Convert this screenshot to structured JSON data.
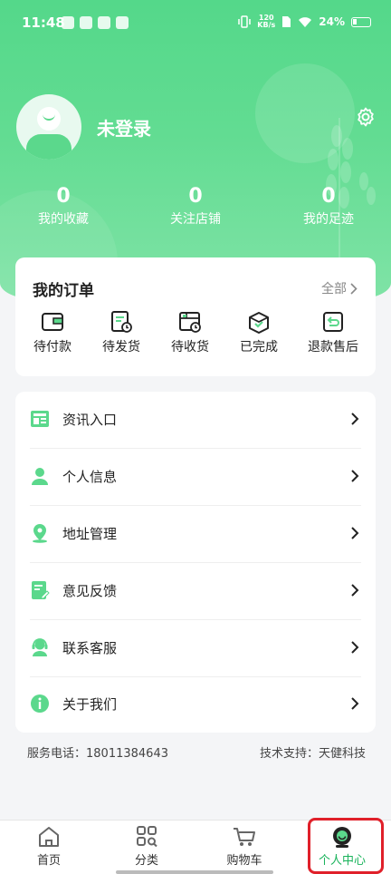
{
  "status_bar": {
    "time": "11:48",
    "net_speed_top": "120",
    "net_speed_bottom": "KB/s",
    "battery": "24%"
  },
  "profile": {
    "username": "未登录"
  },
  "stats": [
    {
      "count": "0",
      "label": "我的收藏"
    },
    {
      "count": "0",
      "label": "关注店铺"
    },
    {
      "count": "0",
      "label": "我的足迹"
    }
  ],
  "orders": {
    "title": "我的订单",
    "all_label": "全部",
    "items": [
      {
        "label": "待付款",
        "icon": "wallet-icon"
      },
      {
        "label": "待发货",
        "icon": "pending-ship-icon"
      },
      {
        "label": "待收货",
        "icon": "pending-receive-icon"
      },
      {
        "label": "已完成",
        "icon": "completed-icon"
      },
      {
        "label": "退款售后",
        "icon": "refund-icon"
      }
    ]
  },
  "menu": [
    {
      "label": "资讯入口",
      "icon": "news-icon"
    },
    {
      "label": "个人信息",
      "icon": "user-icon"
    },
    {
      "label": "地址管理",
      "icon": "location-icon"
    },
    {
      "label": "意见反馈",
      "icon": "feedback-icon"
    },
    {
      "label": "联系客服",
      "icon": "customer-service-icon"
    },
    {
      "label": "关于我们",
      "icon": "info-icon"
    }
  ],
  "footer": {
    "phone": "服务电话：18011384643",
    "tech": "技术支持：天健科技"
  },
  "tabbar": [
    {
      "label": "首页",
      "icon": "home-icon"
    },
    {
      "label": "分类",
      "icon": "category-icon"
    },
    {
      "label": "购物车",
      "icon": "cart-icon"
    },
    {
      "label": "个人中心",
      "icon": "profile-icon",
      "active": true
    }
  ],
  "colors": {
    "primary": "#5bd88c",
    "active_tab": "#19b35b",
    "highlight": "#e0202a"
  }
}
